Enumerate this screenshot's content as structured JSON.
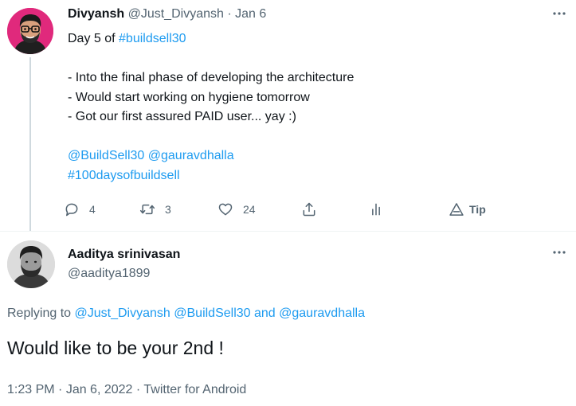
{
  "parent_tweet": {
    "display_name": "Divyansh",
    "handle": "@Just_Divyansh",
    "separator": " · ",
    "date": "Jan 6",
    "more_icon": "more-dots-icon",
    "text_intro": "Day 5 of ",
    "hashtag_buildsell": "#buildsell30",
    "lines": [
      "- Into the final phase of developing the architecture",
      "- Would start working on hygiene tomorrow",
      "- Got our first assured PAID user... yay :)"
    ],
    "mention_buildsell": "@BuildSell30",
    "mention_gaurav": "@gauravdhalla",
    "hashtag_100days": "#100daysofbuildsell",
    "actions": {
      "reply_icon": "reply-icon",
      "reply_count": "4",
      "retweet_icon": "retweet-icon",
      "retweet_count": "3",
      "like_icon": "heart-icon",
      "like_count": "24",
      "share_icon": "share-icon",
      "analytics_icon": "analytics-icon",
      "tip_icon": "tip-icon",
      "tip_label": "Tip"
    }
  },
  "reply_tweet": {
    "display_name": "Aaditya srinivasan",
    "handle": "@aaditya1899",
    "more_icon": "more-dots-icon",
    "replying_prefix": "Replying to ",
    "replying_user1": "@Just_Divyansh",
    "replying_user2": "@BuildSell30",
    "replying_and": " and ",
    "replying_user3": "@gauravdhalla",
    "text": "Would like to be your 2nd !",
    "time": "1:23 PM",
    "meta_sep": " · ",
    "date": "Jan 6, 2022",
    "source": "Twitter for Android"
  },
  "colors": {
    "link": "#1d9bf0",
    "muted": "#536471",
    "text": "#0f1419",
    "avatar1_bg": "#e0297c"
  }
}
